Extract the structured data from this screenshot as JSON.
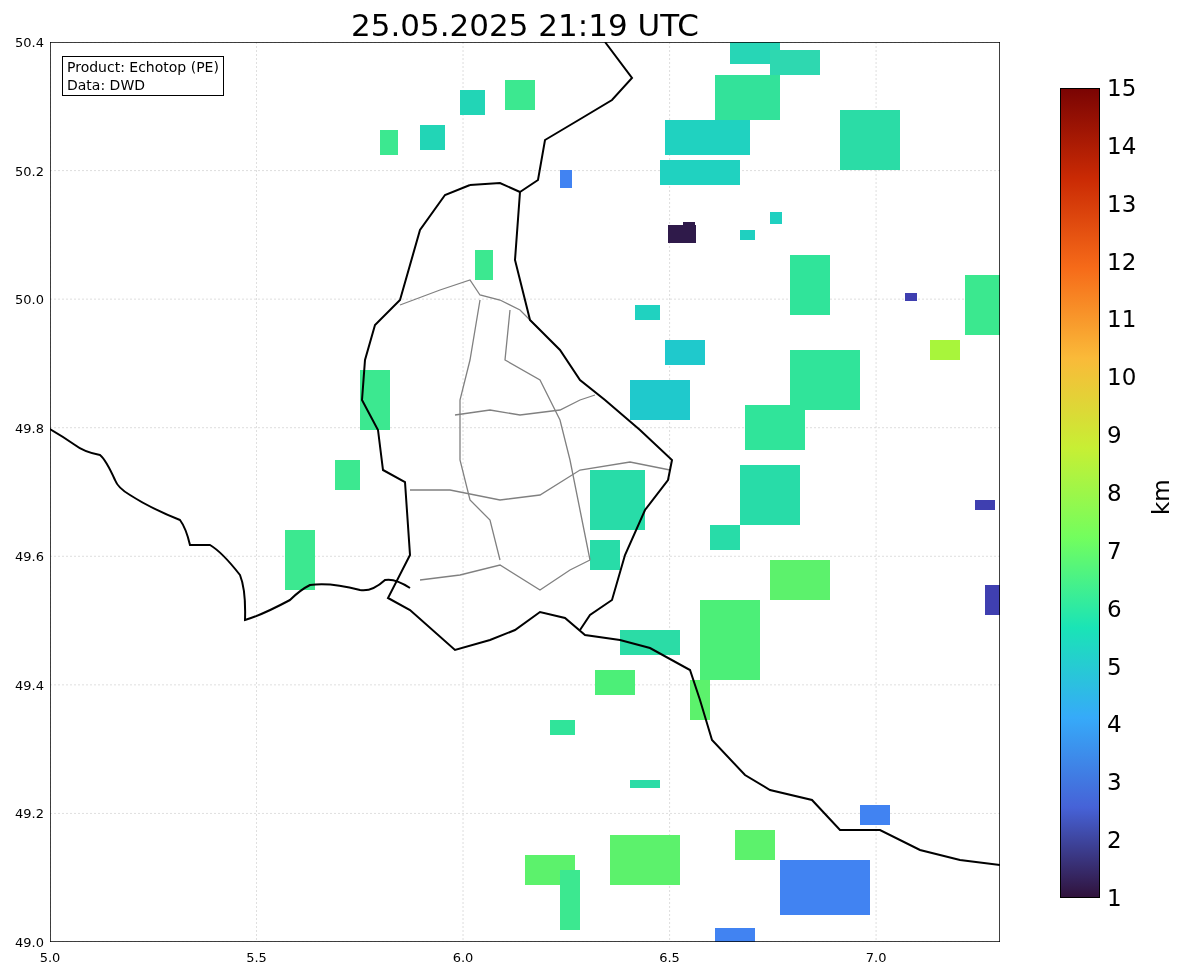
{
  "title": "25.05.2025 21:19 UTC",
  "info_box": [
    "Product: Echotop (PE)",
    "Data: DWD"
  ],
  "x_ticks": [
    "5.0",
    "5.5",
    "6.0",
    "6.5",
    "7.0"
  ],
  "y_ticks": [
    "50.4",
    "50.2",
    "50.0",
    "49.8",
    "49.6",
    "49.4",
    "49.2",
    "49.0"
  ],
  "colorbar": {
    "label": "km",
    "ticks": [
      "15",
      "14",
      "13",
      "12",
      "11",
      "10",
      "9",
      "8",
      "7",
      "6",
      "5",
      "4",
      "3",
      "2",
      "1"
    ]
  }
}
